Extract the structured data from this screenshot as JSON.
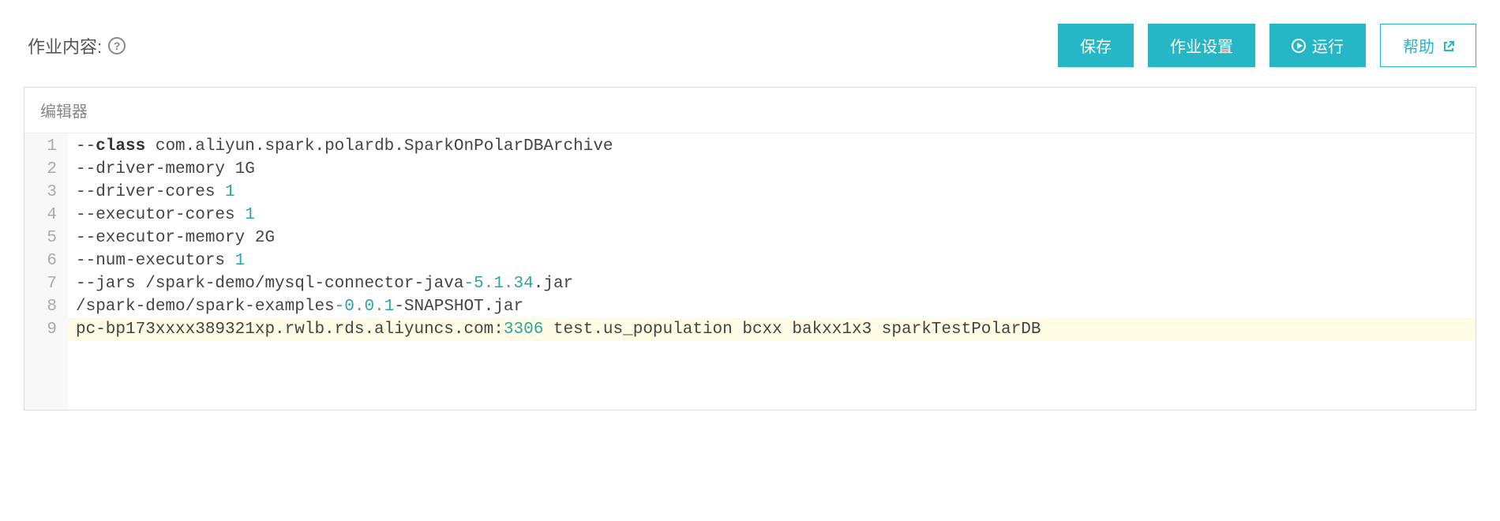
{
  "header": {
    "title": "作业内容:",
    "help_tooltip": "?",
    "buttons": {
      "save": "保存",
      "settings": "作业设置",
      "run": "运行",
      "help": "帮助"
    }
  },
  "editor": {
    "tab_label": "编辑器",
    "lines": [
      [
        {
          "t": "--"
        },
        {
          "t": "class",
          "cls": "keyword"
        },
        {
          "t": " com.aliyun.spark.polardb.SparkOnPolarDBArchive"
        }
      ],
      [
        {
          "t": "--driver-memory 1G"
        }
      ],
      [
        {
          "t": "--driver-cores "
        },
        {
          "t": "1",
          "cls": "number"
        }
      ],
      [
        {
          "t": "--executor-cores "
        },
        {
          "t": "1",
          "cls": "number"
        }
      ],
      [
        {
          "t": "--executor-memory 2G"
        }
      ],
      [
        {
          "t": "--num-executors "
        },
        {
          "t": "1",
          "cls": "number"
        }
      ],
      [
        {
          "t": "--jars /spark-demo/mysql-connector-java"
        },
        {
          "t": "-5",
          "cls": "number"
        },
        {
          "t": ".",
          "cls": "punct"
        },
        {
          "t": "1",
          "cls": "number"
        },
        {
          "t": ".",
          "cls": "punct"
        },
        {
          "t": "34",
          "cls": "number"
        },
        {
          "t": ".jar"
        }
      ],
      [
        {
          "t": "/spark-demo/spark-examples"
        },
        {
          "t": "-0",
          "cls": "number"
        },
        {
          "t": ".",
          "cls": "punct"
        },
        {
          "t": "0",
          "cls": "number"
        },
        {
          "t": ".",
          "cls": "punct"
        },
        {
          "t": "1",
          "cls": "number"
        },
        {
          "t": "-SNAPSHOT.jar"
        }
      ],
      [
        {
          "t": "pc-bp173xxxx389321xp.rwlb.rds.aliyuncs.com:"
        },
        {
          "t": "3306",
          "cls": "number"
        },
        {
          "t": " test.us_population bcxx bakxx1x3 sparkTestPolarDB"
        }
      ]
    ],
    "highlighted_line_index": 8
  }
}
